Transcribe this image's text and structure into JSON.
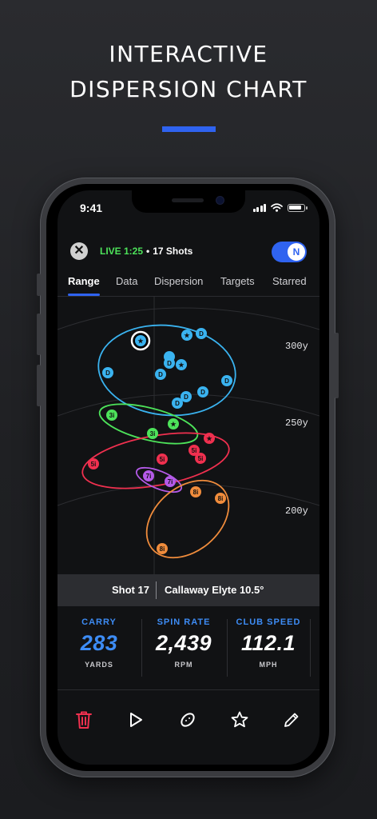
{
  "headline": {
    "line1": "INTERACTIVE",
    "line2": "DISPERSION CHART"
  },
  "colors": {
    "accent": "#2f63f0",
    "live": "#4de35a",
    "driver": "#3ab3f0",
    "iron3": "#4de35a",
    "iron5": "#f0304f",
    "iron7": "#b45ae8",
    "iron8": "#f08c3c",
    "stat_label": "#3d8cf5"
  },
  "status_bar": {
    "time": "9:41",
    "icons": [
      "signal-icon",
      "wifi-icon",
      "battery-icon"
    ]
  },
  "session": {
    "live_label": "LIVE 1:25",
    "separator": "•",
    "shots_label": "17 Shots",
    "toggle_label": "N"
  },
  "tabs": [
    {
      "label": "Range",
      "active": true
    },
    {
      "label": "Data",
      "active": false
    },
    {
      "label": "Dispersion",
      "active": false
    },
    {
      "label": "Targets",
      "active": false
    },
    {
      "label": "Starred",
      "active": false
    }
  ],
  "chart_data": {
    "type": "scatter",
    "yardage_labels": [
      "300y",
      "250y",
      "200y"
    ],
    "clubs": [
      {
        "club": "D",
        "color": "#3ab3f0"
      },
      {
        "club": "3i",
        "color": "#4de35a"
      },
      {
        "club": "5i",
        "color": "#f0304f"
      },
      {
        "club": "7i",
        "color": "#b45ae8"
      },
      {
        "club": "8i",
        "color": "#f08c3c"
      }
    ],
    "shots": [
      {
        "club": "D",
        "label": "★",
        "selected": true
      },
      {
        "club": "D",
        "label": "★"
      },
      {
        "club": "D",
        "label": "D"
      },
      {
        "club": "D",
        "label": ""
      },
      {
        "club": "D",
        "label": "D"
      },
      {
        "club": "D",
        "label": "★"
      },
      {
        "club": "D",
        "label": "D"
      },
      {
        "club": "D",
        "label": "D"
      },
      {
        "club": "D",
        "label": "D"
      },
      {
        "club": "D",
        "label": "D"
      },
      {
        "club": "D",
        "label": "D"
      },
      {
        "club": "D",
        "label": "D"
      },
      {
        "club": "3i",
        "label": "3i"
      },
      {
        "club": "3i",
        "label": "★"
      },
      {
        "club": "3i",
        "label": "3i"
      },
      {
        "club": "5i",
        "label": "★"
      },
      {
        "club": "5i",
        "label": "5i"
      },
      {
        "club": "5i",
        "label": "5i"
      },
      {
        "club": "5i",
        "label": "5i"
      },
      {
        "club": "5i",
        "label": "5i"
      },
      {
        "club": "7i",
        "label": "7i"
      },
      {
        "club": "7i",
        "label": "7i"
      },
      {
        "club": "8i",
        "label": "8i"
      },
      {
        "club": "8i",
        "label": "8i"
      },
      {
        "club": "8i",
        "label": "8i"
      }
    ]
  },
  "shot_info": {
    "shot": "Shot 17",
    "club": "Callaway Elyte 10.5°"
  },
  "stats": [
    {
      "label": "CARRY",
      "value": "283",
      "unit": "YARDS",
      "highlight": true
    },
    {
      "label": "SPIN RATE",
      "value": "2,439",
      "unit": "RPM",
      "highlight": false
    },
    {
      "label": "CLUB SPEED",
      "value": "112.1",
      "unit": "MPH",
      "highlight": false
    }
  ],
  "actions": [
    "trash-icon",
    "play-icon",
    "golf-ball-icon",
    "star-icon",
    "pencil-icon"
  ]
}
